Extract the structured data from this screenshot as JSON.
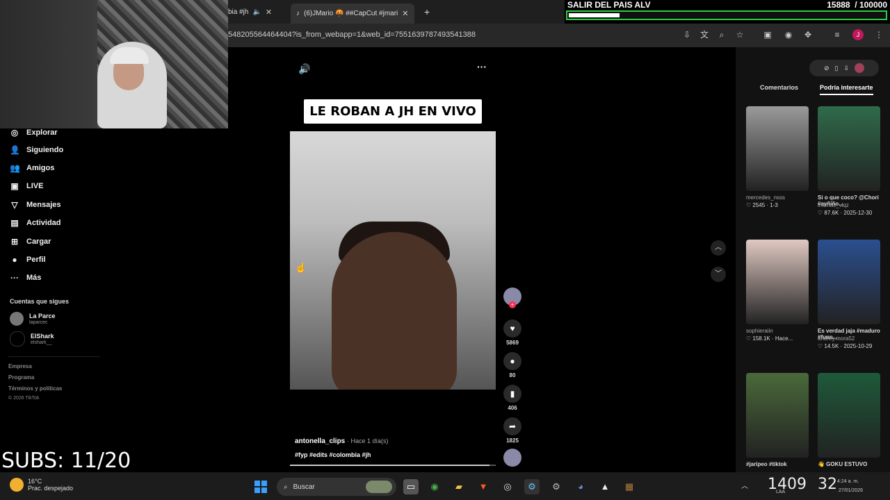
{
  "browser": {
    "tabs": [
      {
        "title": "bia #jh"
      },
      {
        "title": "(6)JMario 🤬 ##CapCut #jmari"
      }
    ],
    "url": "548205564464404?is_from_webapp=1&web_id=7551639787493541388"
  },
  "goal": {
    "title": "SALIR DEL PAIS ALV",
    "current": "15888",
    "target": "/ 100000",
    "progress_fraction": 0.15888
  },
  "sidebar": {
    "items": [
      {
        "label": "Explorar",
        "icon": "compass-icon",
        "glyph": "◎"
      },
      {
        "label": "Siguiendo",
        "icon": "person-icon",
        "glyph": "👤"
      },
      {
        "label": "Amigos",
        "icon": "friends-icon",
        "glyph": "👥"
      },
      {
        "label": "LIVE",
        "icon": "live-icon",
        "glyph": "▣"
      },
      {
        "label": "Mensajes",
        "icon": "send-icon",
        "glyph": "▽"
      },
      {
        "label": "Actividad",
        "icon": "activity-icon",
        "glyph": "▤"
      },
      {
        "label": "Cargar",
        "icon": "upload-icon",
        "glyph": "⊞"
      },
      {
        "label": "Perfil",
        "icon": "profile-avatar-icon",
        "glyph": "●"
      },
      {
        "label": "Más",
        "icon": "more-icon",
        "glyph": "···"
      }
    ],
    "following_title": "Cuentas que sigues",
    "accounts": [
      {
        "name": "La Parce",
        "handle": "laparcec"
      },
      {
        "name": "ElShark",
        "handle": "elshark__"
      }
    ],
    "footer": [
      "Empresa",
      "Programa",
      "Términos y políticas"
    ],
    "copyright": "© 2026 TikTok"
  },
  "overlay": {
    "subs": "SUBS: 11/20"
  },
  "video": {
    "caption": "LE ROBAN A JH EN VIVO",
    "author": "antonella_clips",
    "time": "· Hace 1 día(s)",
    "tags": "#fyp #edits #colombia #jh",
    "likes": "5869",
    "comments": "80",
    "saves": "406",
    "shares": "1825",
    "progress_fraction": 0.97
  },
  "rightpanel": {
    "tab_comments": "Comentarios",
    "tab_suggested": "Podría interesarte",
    "videos": [
      {
        "title": "",
        "user": "mercedes_nsss",
        "stats": "♡ 2545 · 1-3",
        "color": "#9a9a9a"
      },
      {
        "title": "Si o que coco? @Chori #ayñiño...",
        "user": "thomas_vlqz",
        "stats": "♡ 87.6K · 2025-12-30",
        "color": "#2f6b4a"
      },
      {
        "title": "",
        "user": "sophieraiin",
        "stats": "♡ 158.1K · Hace...",
        "color": "#e0c9c2"
      },
      {
        "title": "Es verdad jaja #maduro #funn...",
        "user": "andrey.mora52",
        "stats": "♡ 14.5K · 2025-10-29",
        "color": "#2b4f8f"
      },
      {
        "title": "#jaripeo #tiktok",
        "user": "",
        "stats": "",
        "color": "#4a6a3a"
      },
      {
        "title": "👋 GOKU ESTUVO",
        "user": "",
        "stats": "",
        "color": "#1e5a3a"
      }
    ]
  },
  "taskbar": {
    "weather_temp": "16°C",
    "weather_desc": "Prac. despejado",
    "search": "Buscar",
    "clock_big": "1409",
    "clock_big2": "32",
    "time": "4:24 a. m.",
    "date": "27/01/2026",
    "lang": "LAA"
  }
}
